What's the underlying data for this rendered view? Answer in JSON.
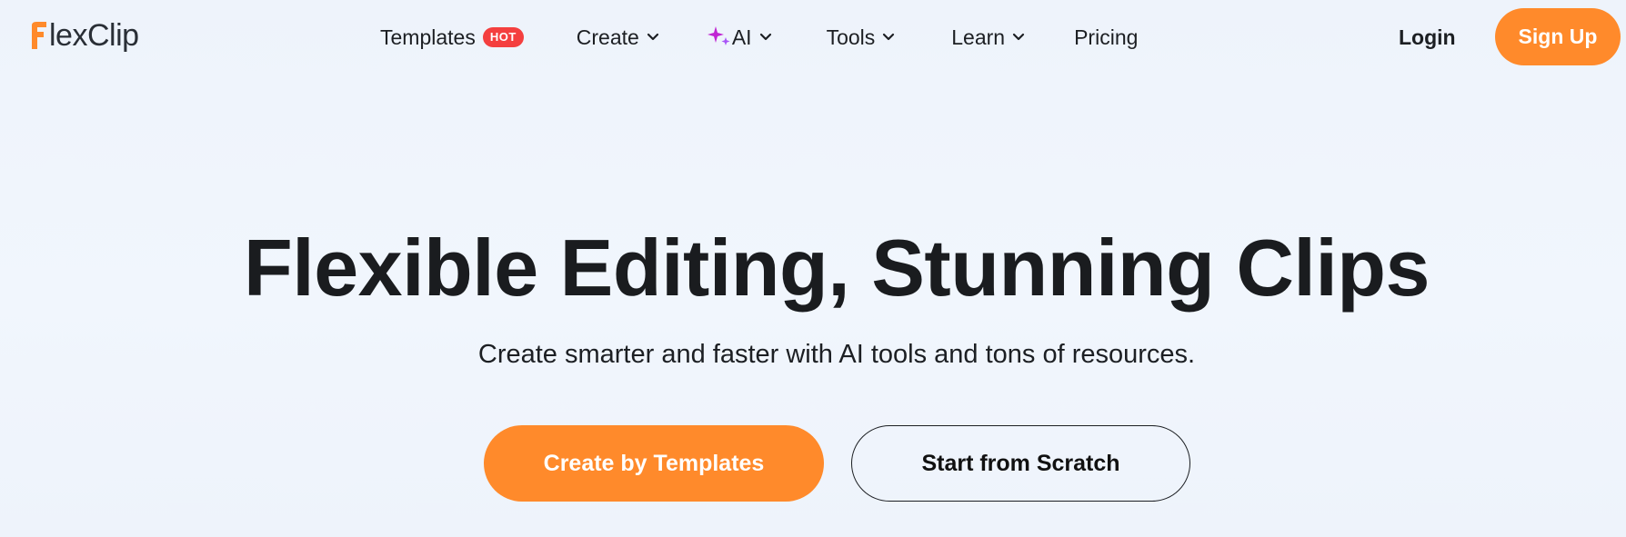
{
  "brand": {
    "logo_text": "lexClip",
    "logo_mark_letter": "F",
    "accent_color": "#ff8a2b"
  },
  "nav": {
    "templates": {
      "label": "Templates",
      "badge": "HOT"
    },
    "create": {
      "label": "Create"
    },
    "ai": {
      "label": "AI",
      "icon": "sparkle-icon"
    },
    "tools": {
      "label": "Tools"
    },
    "learn": {
      "label": "Learn"
    },
    "pricing": {
      "label": "Pricing"
    }
  },
  "auth": {
    "login_label": "Login",
    "signup_label": "Sign Up"
  },
  "hero": {
    "title": "Flexible Editing, Stunning Clips",
    "subtitle": "Create smarter and faster with AI tools and tons of resources.",
    "primary_cta": "Create by Templates",
    "secondary_cta": "Start from Scratch"
  },
  "colors": {
    "badge_red": "#f43f3f",
    "sparkle_purple": "#c026d3",
    "background": "#eef3fb"
  }
}
